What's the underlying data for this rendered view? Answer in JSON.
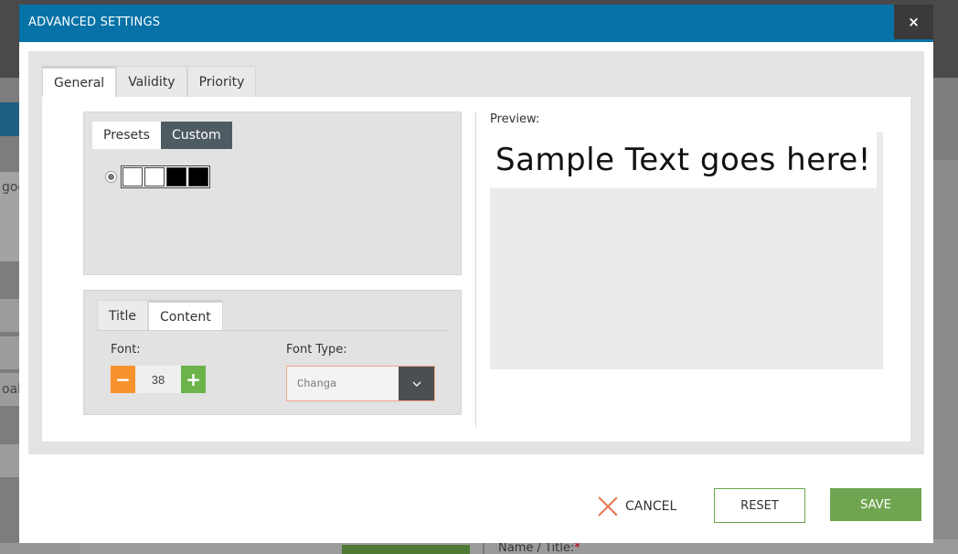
{
  "modal": {
    "title": "ADVANCED SETTINGS",
    "close_glyph": "×"
  },
  "tabs": [
    {
      "label": "General",
      "active": true
    },
    {
      "label": "Validity",
      "active": false
    },
    {
      "label": "Priority",
      "active": false
    }
  ],
  "presets": {
    "tabs": [
      {
        "label": "Presets",
        "active": false
      },
      {
        "label": "Custom",
        "active": true
      }
    ],
    "swatch_colors": [
      "#ffffff",
      "#ffffff",
      "#000000",
      "#000000"
    ]
  },
  "font_panel": {
    "tabs": [
      {
        "label": "Title",
        "active": false
      },
      {
        "label": "Content",
        "active": true
      }
    ],
    "font_label": "Font:",
    "font_size": "38",
    "minus_glyph": "−",
    "plus_glyph": "+",
    "font_type_label": "Font Type:",
    "font_type_value": "Changa"
  },
  "preview": {
    "label": "Preview:",
    "sample_text": "Sample Text goes here!"
  },
  "footer": {
    "cancel_label": "CANCEL",
    "reset_label": "RESET",
    "save_label": "SAVE"
  },
  "background": {
    "partial_text_1": "goo",
    "partial_text_2": "oak",
    "name_title_label": "Name / Title:",
    "required_mark": "*"
  },
  "colors": {
    "header_blue": "#0672a7",
    "save_green": "#6fa550",
    "minus_orange": "#f7922d",
    "plus_green": "#6cb44a",
    "cancel_red": "#e9744f"
  }
}
